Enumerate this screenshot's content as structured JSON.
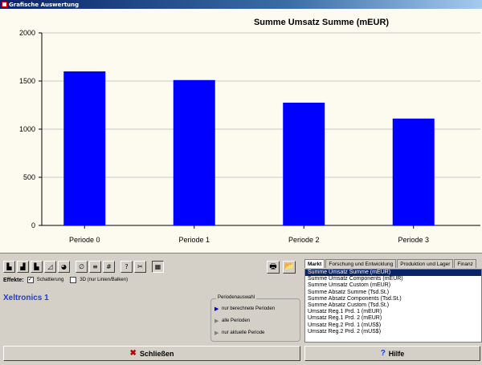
{
  "window": {
    "title": "Grafische Auswertung"
  },
  "chart_data": {
    "type": "bar",
    "title": "Summe Umsatz Summe (mEUR)",
    "categories": [
      "Periode 0",
      "Periode 1",
      "Periode 2",
      "Periode 3"
    ],
    "values": [
      1600,
      1510,
      1275,
      1110
    ],
    "ylim": [
      0,
      2000
    ],
    "yticks": [
      0,
      500,
      1000,
      1500,
      2000
    ],
    "bar_color": "#0000ff",
    "grid": true,
    "legend": "none"
  },
  "toolbar": {
    "buttons": [
      {
        "icon": "bar-chart-icon",
        "glyph": "▙"
      },
      {
        "icon": "bar-chart-2-icon",
        "glyph": "▟"
      },
      {
        "icon": "bar-chart-3-icon",
        "glyph": "▙"
      },
      {
        "icon": "line-chart-icon",
        "glyph": "◿"
      },
      {
        "icon": "pie-chart-icon",
        "glyph": "◕"
      },
      {
        "icon": "no-fill-icon",
        "glyph": "∅"
      },
      {
        "icon": "lines-icon",
        "glyph": "≡"
      },
      {
        "icon": "grid-icon",
        "glyph": "#"
      },
      {
        "icon": "help-icon",
        "glyph": "?"
      },
      {
        "icon": "tool-icon",
        "glyph": "✂"
      },
      {
        "icon": "calculator-icon",
        "glyph": "▦"
      }
    ],
    "effekte_label": "Effekte:",
    "shading_label": "Schattierung",
    "shading_checked": "✓",
    "threed_label": "3D (nur Linien/Balken)"
  },
  "company": "Xeltronics 1",
  "period": {
    "legend": "Periodenauswahl",
    "options": [
      "nur berechnete Perioden",
      "alle Perioden",
      "nur aktuelle Periode"
    ],
    "marks": [
      "▶",
      "▶",
      "▶"
    ]
  },
  "tabs": [
    "Markt",
    "Forschung und Entwicklung",
    "Produktion und Lager",
    "Finanz"
  ],
  "list": [
    "Summe Umsatz Summe (mEUR)",
    "Summe Umsatz Components (mEUR)",
    "Summe Umsatz Custom (mEUR)",
    "Summe Absatz Summe (Tsd.St.)",
    "Summe Absatz Components (Tsd.St.)",
    "Summe Absatz Custom (Tsd.St.)",
    "Umsatz Reg.1 Prd. 1 (mEUR)",
    "Umsatz Reg.1 Prd. 2 (mEUR)",
    "Umsatz Reg.2 Prd. 1 (mUS$)",
    "Umsatz Reg.2 Prd. 2 (mUS$)"
  ],
  "buttons": {
    "close_label": "Schließen",
    "close_icon": "✖",
    "help_label": "Hilfe",
    "help_icon": "?",
    "print_icon": "🖶",
    "export_icon": "📂"
  }
}
